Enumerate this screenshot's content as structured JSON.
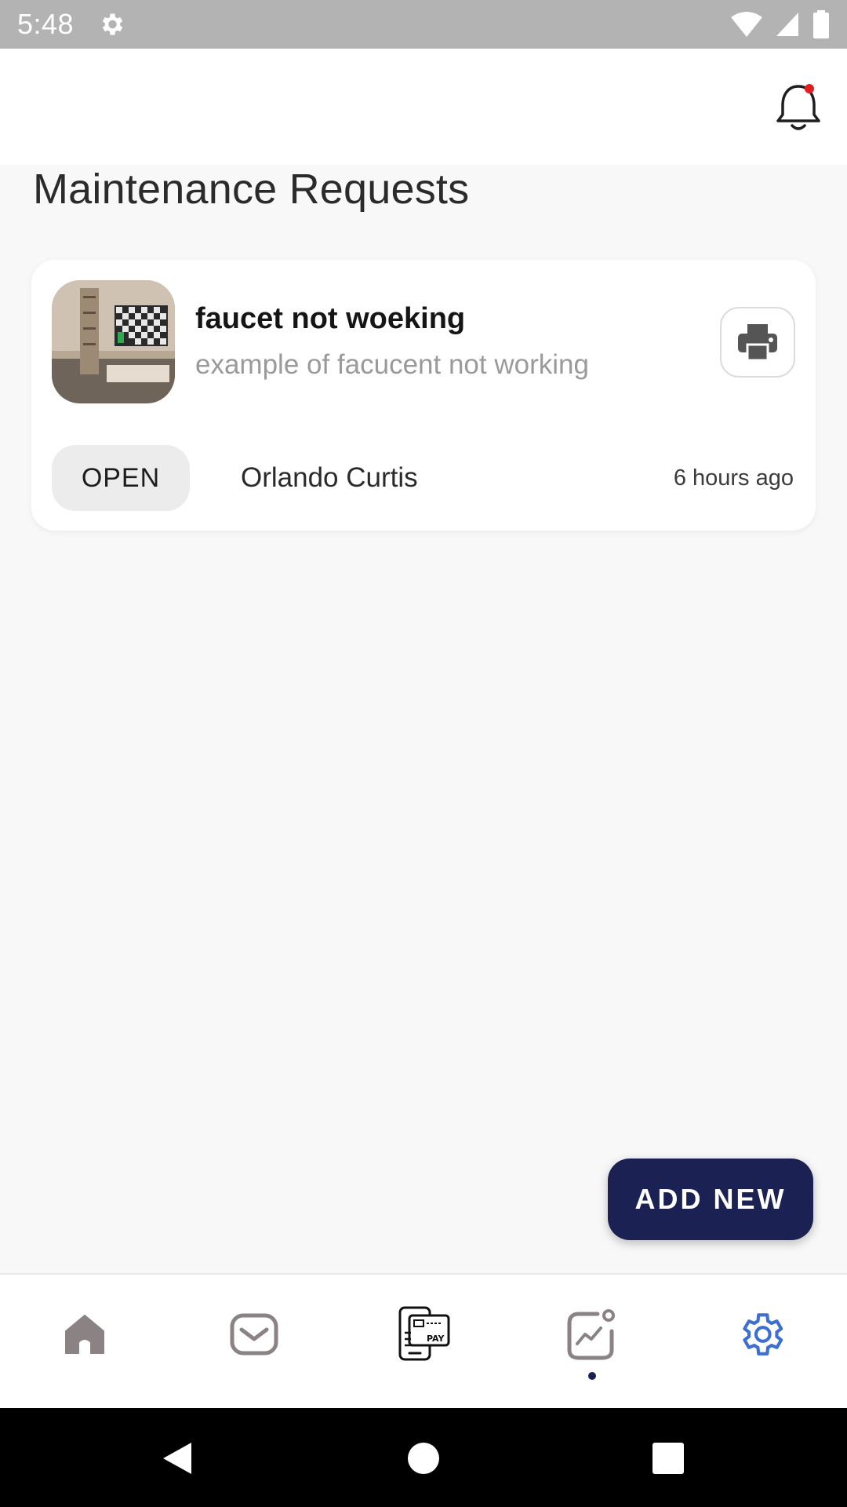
{
  "status_bar": {
    "time": "5:48"
  },
  "page": {
    "title": "Maintenance Requests"
  },
  "request": {
    "title": "faucet not woeking",
    "description": "example of facucent not working",
    "status": "OPEN",
    "requester": "Orlando Curtis",
    "time_ago": "6 hours ago"
  },
  "fab": {
    "label": "ADD NEW"
  },
  "nav": {
    "items": [
      {
        "icon": "home-icon"
      },
      {
        "icon": "mail-icon"
      },
      {
        "icon": "pay-icon",
        "badge_text": "PAY"
      },
      {
        "icon": "chart-icon"
      },
      {
        "icon": "settings-icon"
      }
    ]
  },
  "colors": {
    "brand_navy": "#1b2253",
    "active_nav": "#3b6fd1",
    "notification_dot": "#e02020"
  }
}
